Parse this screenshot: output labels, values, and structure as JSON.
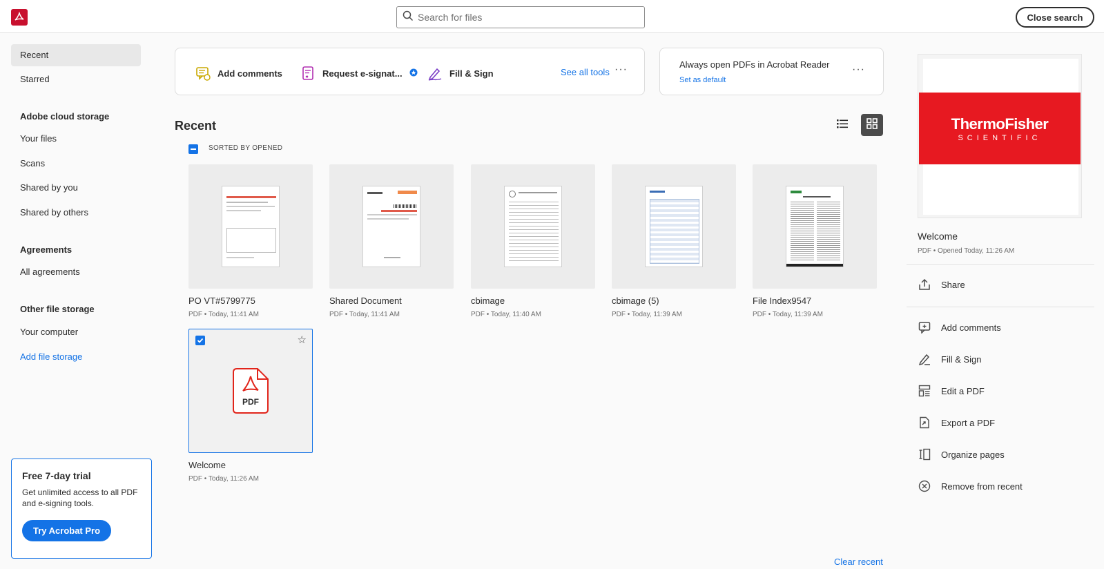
{
  "header": {
    "search_placeholder": "Search for files",
    "close_search_label": "Close search"
  },
  "sidebar": {
    "recent": "Recent",
    "starred": "Starred",
    "cloud_heading": "Adobe cloud storage",
    "your_files": "Your files",
    "scans": "Scans",
    "shared_by_you": "Shared by you",
    "shared_by_others": "Shared by others",
    "agreements_heading": "Agreements",
    "all_agreements": "All agreements",
    "other_heading": "Other file storage",
    "your_computer": "Your computer",
    "add_file_storage": "Add file storage"
  },
  "trial": {
    "title": "Free 7-day trial",
    "body": "Get unlimited access to all PDF and e-signing tools.",
    "button": "Try Acrobat Pro"
  },
  "tools": {
    "add_comments": "Add comments",
    "request_esign": "Request e-signat...",
    "fill_sign": "Fill & Sign",
    "see_all": "See all tools",
    "more": "···"
  },
  "default_card": {
    "title": "Always open PDFs in Acrobat Reader",
    "link": "Set as default",
    "more": "···"
  },
  "recent": {
    "title": "Recent",
    "sort_label": "SORTED BY OPENED",
    "files": [
      {
        "name": "PO VT#5799775",
        "type": "PDF",
        "time": "Today, 11:41 AM"
      },
      {
        "name": "Shared Document",
        "type": "PDF",
        "time": "Today, 11:41 AM"
      },
      {
        "name": "cbimage",
        "type": "PDF",
        "time": "Today, 11:40 AM"
      },
      {
        "name": "cbimage (5)",
        "type": "PDF",
        "time": "Today, 11:39 AM"
      },
      {
        "name": "File Index9547",
        "type": "PDF",
        "time": "Today, 11:39 AM"
      },
      {
        "name": "Welcome",
        "type": "PDF",
        "time": "Today, 11:26 AM"
      }
    ],
    "pdf_badge": "PDF",
    "clear": "Clear recent"
  },
  "right_panel": {
    "logo_line1": "ThermoFisher",
    "logo_line2": "SCIENTIFIC",
    "name": "Welcome",
    "meta": "PDF  •  Opened Today, 11:26 AM",
    "share": "Share",
    "add_comments": "Add comments",
    "fill_sign": "Fill & Sign",
    "edit_pdf": "Edit a PDF",
    "export_pdf": "Export a PDF",
    "organize": "Organize pages",
    "remove": "Remove from recent"
  },
  "colors": {
    "accent": "#1473e6",
    "brand": "#c8102e",
    "thermo_red": "#e71921"
  }
}
